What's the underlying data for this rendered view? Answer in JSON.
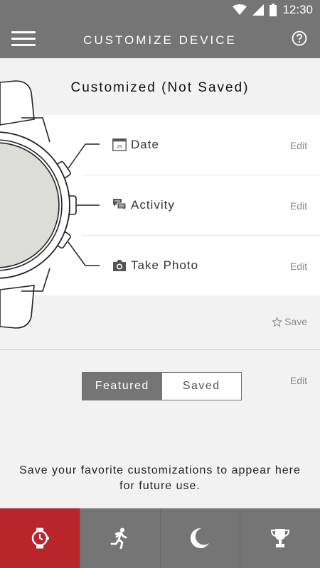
{
  "status_bar": {
    "time": "12:30"
  },
  "app_bar": {
    "title": "CUSTOMIZE DEVICE"
  },
  "customization": {
    "status": "Customized (Not Saved)",
    "buttons": [
      {
        "label": "Date",
        "icon": "calendar-icon",
        "icon_text": "25",
        "edit_label": "Edit"
      },
      {
        "label": "Activity",
        "icon": "chat-bubbles-icon",
        "edit_label": "Edit"
      },
      {
        "label": "Take Photo",
        "icon": "camera-icon",
        "edit_label": "Edit"
      }
    ],
    "save_label": "Save"
  },
  "segments": {
    "featured": "Featured",
    "saved": "Saved",
    "selected": "Featured"
  },
  "saved_edit_label": "Edit",
  "empty_message": "Save your favorite customizations to appear here for future use.",
  "bottom_nav": [
    {
      "name": "watch-tab",
      "icon": "watch-icon",
      "active": true
    },
    {
      "name": "activity-tab",
      "icon": "runner-icon",
      "active": false
    },
    {
      "name": "sleep-tab",
      "icon": "moon-icon",
      "active": false
    },
    {
      "name": "goals-tab",
      "icon": "trophy-icon",
      "active": false
    }
  ],
  "colors": {
    "bar": "#757575",
    "active_tab": "#b8262c",
    "background": "#f2f2f2"
  }
}
